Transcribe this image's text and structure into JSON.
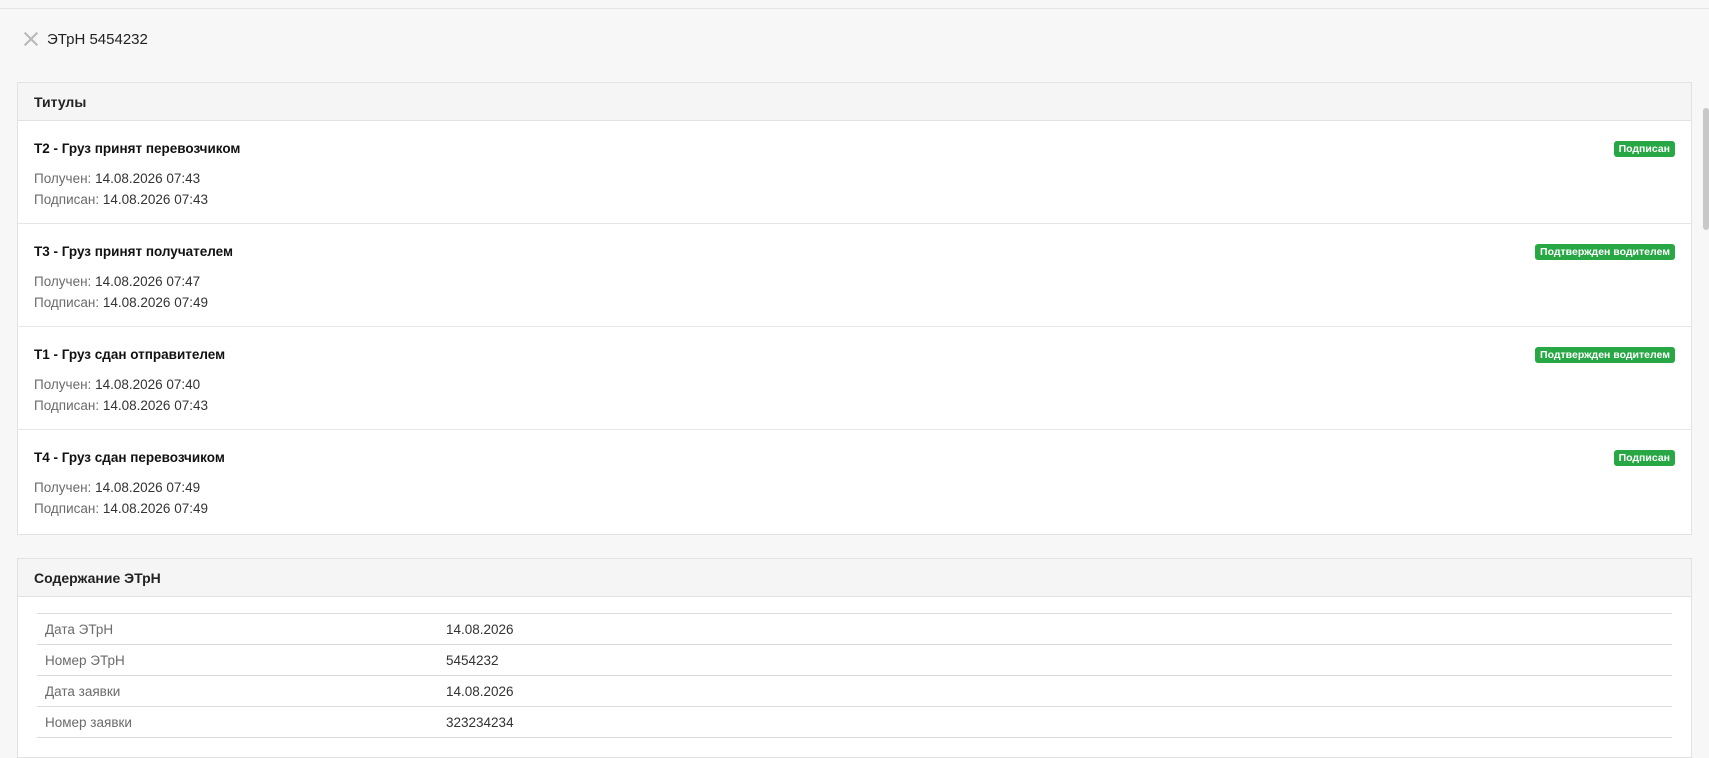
{
  "header": {
    "title": "ЭТрН 5454232"
  },
  "titles_card": {
    "heading": "Титулы",
    "received_label": "Получен:",
    "signed_label": "Подписан:",
    "items": [
      {
        "name": "Т2 - Груз принят перевозчиком",
        "received": "14.08.2026 07:43",
        "signed": "14.08.2026 07:43",
        "status": "Подписан"
      },
      {
        "name": "Т3 - Груз принят получателем",
        "received": "14.08.2026 07:47",
        "signed": "14.08.2026 07:49",
        "status": "Подтвержден водителем"
      },
      {
        "name": "Т1 - Груз сдан отправителем",
        "received": "14.08.2026 07:40",
        "signed": "14.08.2026 07:43",
        "status": "Подтвержден водителем"
      },
      {
        "name": "Т4 - Груз сдан перевозчиком",
        "received": "14.08.2026 07:49",
        "signed": "14.08.2026 07:49",
        "status": "Подписан"
      }
    ]
  },
  "content_card": {
    "heading": "Содержание ЭТрН",
    "rows": [
      {
        "label": "Дата ЭТрН",
        "value": "14.08.2026"
      },
      {
        "label": "Номер ЭТрН",
        "value": "5454232"
      },
      {
        "label": "Дата заявки",
        "value": "14.08.2026"
      },
      {
        "label": "Номер заявки",
        "value": "323234234"
      }
    ]
  },
  "colors": {
    "badge": "#28a745",
    "background": "#f7f7f7"
  }
}
